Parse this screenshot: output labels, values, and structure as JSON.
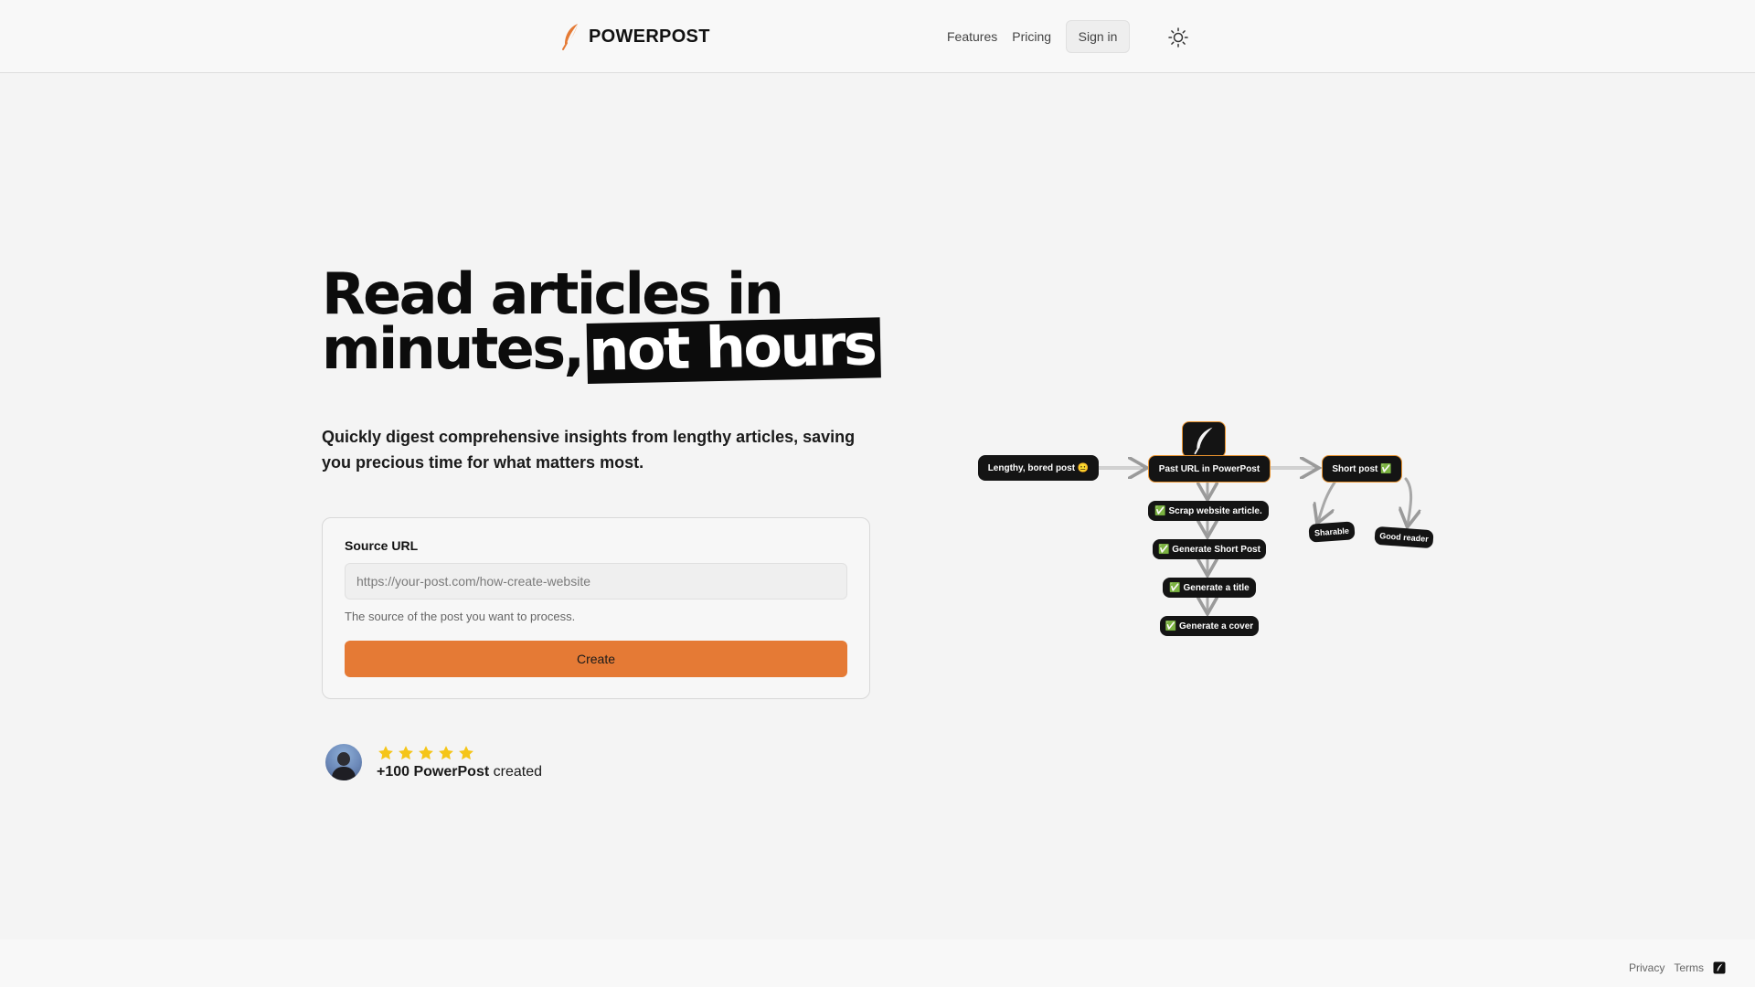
{
  "brand": {
    "name": "POWERPOST",
    "accent": "#e57a35"
  },
  "nav": {
    "features": "Features",
    "pricing": "Pricing",
    "signin": "Sign in",
    "theme_icon": "sun-icon"
  },
  "hero": {
    "title_line1": "Read articles in",
    "title_line2": "minutes,",
    "title_highlight": "not hours",
    "subtitle": "Quickly digest comprehensive insights from lengthy articles, saving you precious time for what matters most."
  },
  "form": {
    "label": "Source URL",
    "placeholder": "https://your-post.com/how-create-website",
    "value": "",
    "help": "The source of the post you want to process.",
    "button": "Create"
  },
  "proof": {
    "rating": 5,
    "rating_max": 5,
    "count": "+100 PowerPost",
    "suffix": " created"
  },
  "diagram": {
    "source_node": "Lengthy, bored post 😐",
    "center_node": "Past URL in PowerPost",
    "result_node": "Short post ✅",
    "steps": [
      "✅ Scrap website article.",
      "✅ Generate Short Post",
      "✅ Generate a title",
      "✅ Generate a cover"
    ],
    "outcomes": [
      "Sharable",
      "Good reader"
    ]
  },
  "footer": {
    "privacy": "Privacy",
    "terms": "Terms"
  }
}
